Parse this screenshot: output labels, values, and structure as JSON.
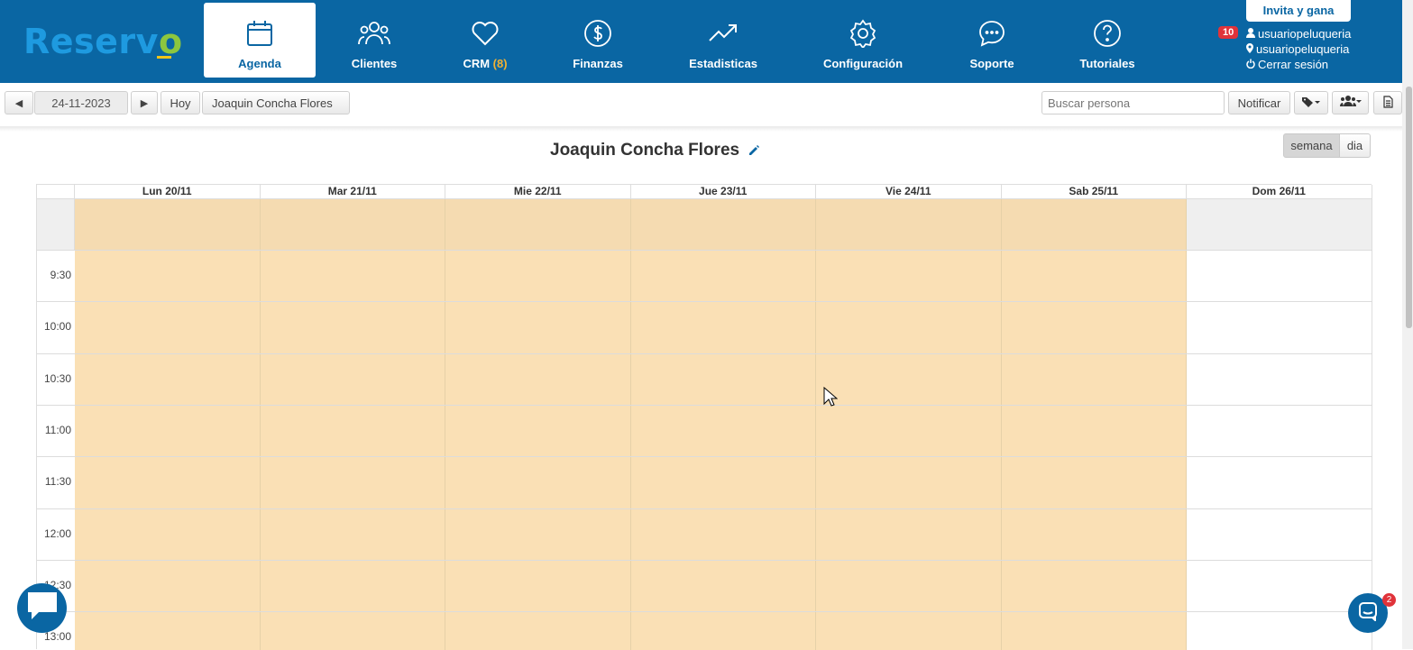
{
  "brand": {
    "logo_text": "Reserv",
    "logo_check": "o"
  },
  "nav": {
    "agenda": "Agenda",
    "clientes": "Clientes",
    "crm": "CRM",
    "crm_count": "(8)",
    "finanzas": "Finanzas",
    "estadisticas": "Estadisticas",
    "configuracion": "Configuración",
    "soporte": "Soporte",
    "tutoriales": "Tutoriales"
  },
  "account": {
    "invite_label": "Invita y gana",
    "notifications": "10",
    "username": "usuariopeluqueria",
    "location": "usuariopeluqueria",
    "logout": "Cerrar sesión"
  },
  "toolbar": {
    "prev": "◀",
    "date": "24-11-2023",
    "next": "▶",
    "today": "Hoy",
    "professional": "Joaquin Concha Flores",
    "search_placeholder": "Buscar persona",
    "notify": "Notificar"
  },
  "calendar": {
    "title": "Joaquin Concha Flores",
    "view_week": "semana",
    "view_day": "dia",
    "days": [
      "Lun 20/11",
      "Mar 21/11",
      "Mie 22/11",
      "Jue 23/11",
      "Vie 24/11",
      "Sab 25/11",
      "Dom 26/11"
    ],
    "times": [
      "9:30",
      "10:00",
      "10:30",
      "11:00",
      "11:30",
      "12:00",
      "12:30",
      "13:00"
    ]
  },
  "chat": {
    "unread": "2"
  },
  "colors": {
    "brand_blue": "#0a66a3",
    "open_slot": "#fae0b5",
    "accent_green": "#8cc63f",
    "crm_orange": "#f2b233"
  }
}
